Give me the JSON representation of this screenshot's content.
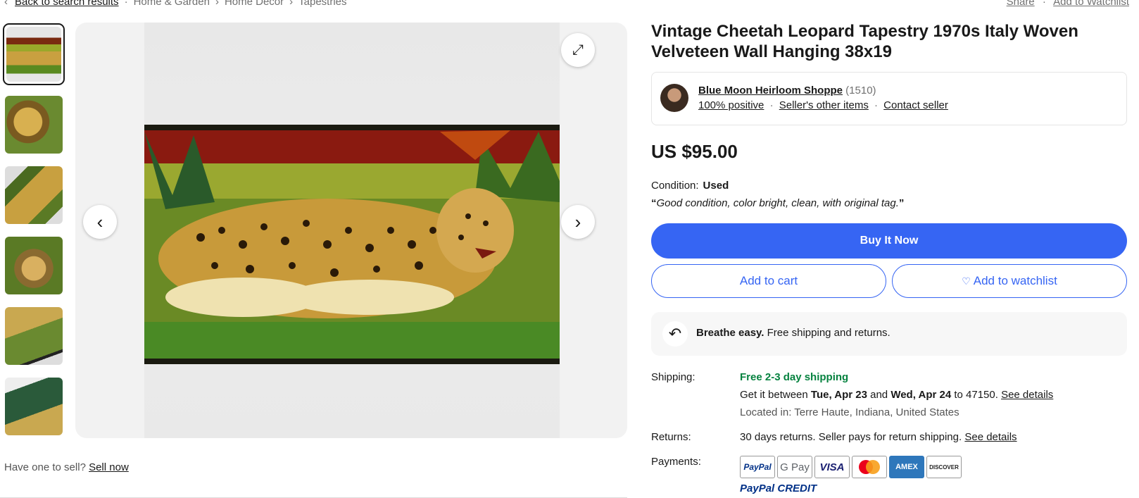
{
  "breadcrumbs": {
    "back_label": "Back to search results",
    "items": [
      "Home & Garden",
      "Home Decor",
      "Tapestries"
    ]
  },
  "top_links": {
    "share": "Share",
    "watchlist": "Add to Watchlist"
  },
  "gallery": {
    "thumbnail_count": 6,
    "selected_index": 0
  },
  "sell_prompt": {
    "text": "Have one to sell?",
    "link": "Sell now"
  },
  "item": {
    "title": "Vintage Cheetah Leopard Tapestry 1970s Italy Woven Velveteen Wall Hanging 38x19",
    "price": "US $95.00",
    "condition_label": "Condition:",
    "condition_value": "Used",
    "condition_note": "Good condition, color bright, clean, with original tag."
  },
  "seller": {
    "name": "Blue Moon Heirloom Shoppe",
    "feedback_count": "(1510)",
    "positive": "100% positive",
    "other_items": "Seller's other items",
    "contact": "Contact seller"
  },
  "actions": {
    "buy_now": "Buy It Now",
    "add_to_cart": "Add to cart",
    "add_to_watchlist": "Add to watchlist"
  },
  "breathe": {
    "bold": "Breathe easy.",
    "text": "Free shipping and returns."
  },
  "shipping": {
    "label": "Shipping:",
    "headline": "Free 2-3 day shipping",
    "get_it": "Get it between",
    "date_from": "Tue, Apr 23",
    "and": "and",
    "date_to": "Wed, Apr 24",
    "to_zip": "to 47150.",
    "details_link": "See details",
    "location": "Located in: Terre Haute, Indiana, United States"
  },
  "returns": {
    "label": "Returns:",
    "text": "30 days returns. Seller pays for return shipping.",
    "details_link": "See details"
  },
  "payments": {
    "label": "Payments:",
    "methods": [
      "PayPal",
      "G Pay",
      "VISA",
      "Mastercard",
      "AMEX",
      "DISCOVER"
    ],
    "credit": "PayPal CREDIT"
  },
  "colors": {
    "accent": "#3665f3",
    "success": "#05823f",
    "text": "#191919"
  }
}
